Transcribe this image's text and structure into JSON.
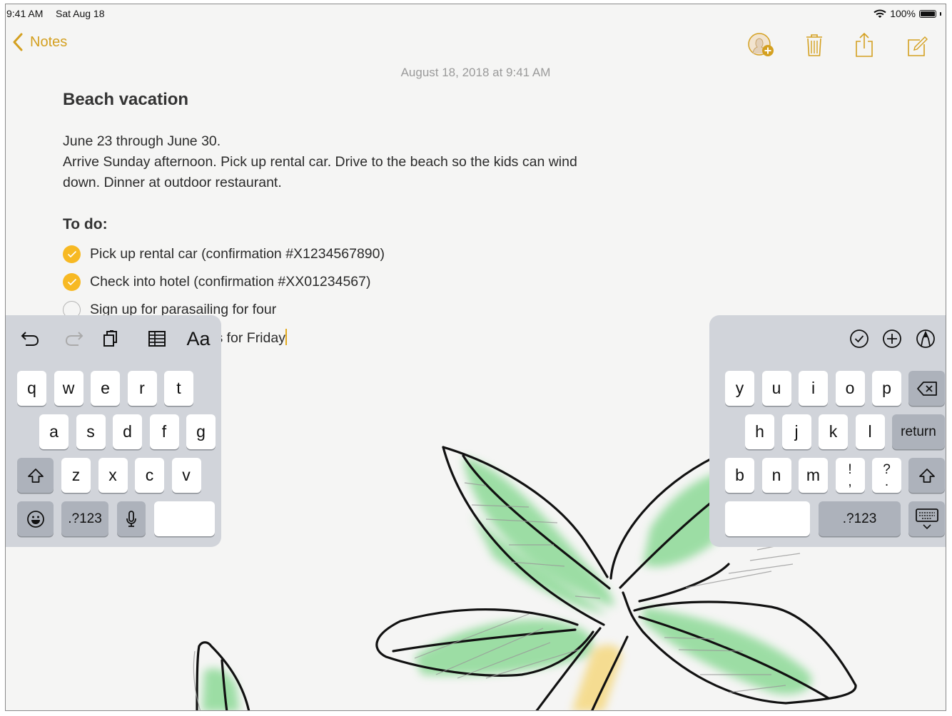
{
  "status_bar": {
    "time": "9:41 AM",
    "date": "Sat Aug 18",
    "battery_text": "100%",
    "battery_level": 1.0,
    "wifi_icon": "wifi-icon"
  },
  "nav": {
    "back_label": "Notes",
    "accent_color": "#d4a020",
    "actions": [
      "add-people",
      "delete",
      "share",
      "compose"
    ]
  },
  "note": {
    "timestamp": "August 18, 2018 at 9:41 AM",
    "title": "Beach vacation",
    "body_lines": [
      "June 23 through June 30.",
      "Arrive Sunday afternoon. Pick up rental car. Drive to the beach so the kids can wind",
      "down. Dinner at outdoor restaurant."
    ],
    "todo_heading": "To do:",
    "checklist": [
      {
        "text": "Pick up rental car (confirmation #X1234567890)",
        "checked": true
      },
      {
        "text": "Check into hotel (confirmation #XX01234567)",
        "checked": true
      },
      {
        "text": "Sign up for parasailing for four",
        "checked": false
      },
      {
        "text": "tions for Friday",
        "checked": false,
        "partially_hidden": true
      }
    ],
    "check_color": "#f7b923"
  },
  "keyboard": {
    "left_toolbar": [
      "undo-icon",
      "redo-icon",
      "paste-icon",
      "table-icon",
      "format-text-icon"
    ],
    "format_label": "Aa",
    "right_toolbar": [
      "checklist-icon",
      "add-icon",
      "markup-pen-icon"
    ],
    "left_rows": [
      [
        "q",
        "w",
        "e",
        "r",
        "t"
      ],
      [
        "a",
        "s",
        "d",
        "f",
        "g"
      ],
      [
        "z",
        "x",
        "c",
        "v"
      ]
    ],
    "right_rows": [
      [
        "y",
        "u",
        "i",
        "o",
        "p"
      ],
      [
        "h",
        "j",
        "k",
        "l"
      ],
      [
        "b",
        "n",
        "m"
      ]
    ],
    "punct_keys": [
      {
        "top": "!",
        "bottom": ","
      },
      {
        "top": "?",
        "bottom": "."
      }
    ],
    "numbers_label": ".?123",
    "return_label": "return",
    "space_label": ""
  }
}
